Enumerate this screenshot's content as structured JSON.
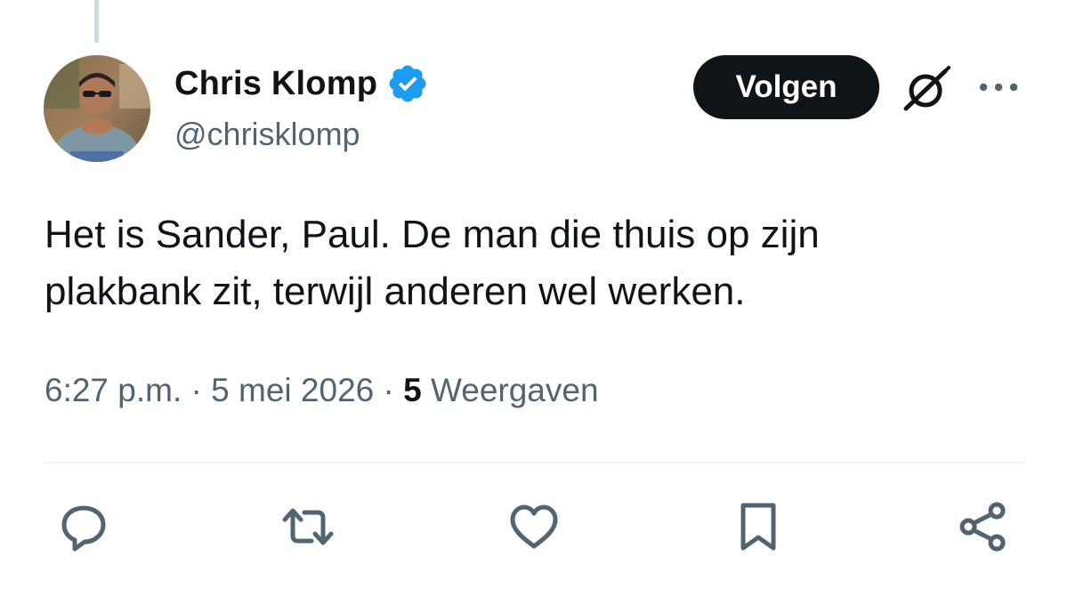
{
  "author": {
    "display_name": "Chris Klomp",
    "handle": "@chrisklomp",
    "verified": true,
    "avatar_icon": "profile-photo"
  },
  "header_actions": {
    "follow_label": "Volgen",
    "grok_icon": "grok-icon",
    "more_icon": "more-dots-icon"
  },
  "tweet": {
    "text_lines": [
      "Het is Sander, Paul. De man die thuis op zijn",
      "plakbank zit, terwijl anderen wel werken."
    ]
  },
  "meta": {
    "time": "6:27 p.m.",
    "separator": "·",
    "date": "5 mei 2026",
    "views_count": "5",
    "views_label": "Weergaven"
  },
  "actions": [
    {
      "icon": "reply-icon"
    },
    {
      "icon": "retweet-icon"
    },
    {
      "icon": "like-icon"
    },
    {
      "icon": "bookmark-icon"
    },
    {
      "icon": "share-icon"
    }
  ],
  "colors": {
    "text": "#0f1419",
    "secondary": "#536471",
    "verified": "#1d9bf0",
    "follow_bg": "#0f1419",
    "divider": "#eff3f4"
  }
}
